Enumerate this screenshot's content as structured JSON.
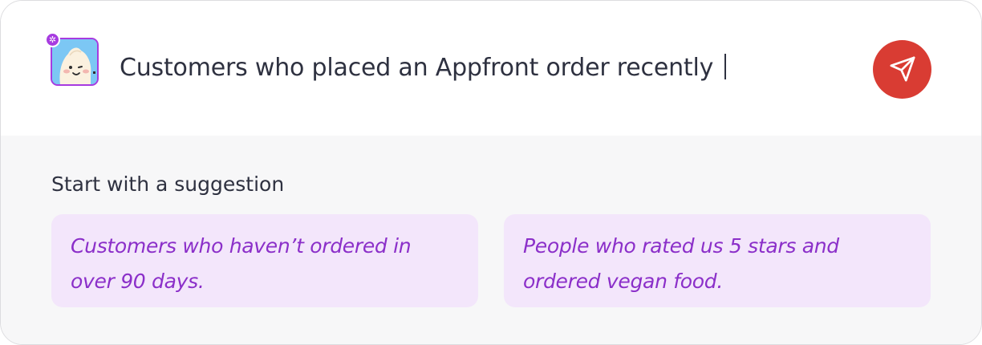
{
  "prompt": {
    "query_text": "Customers who placed an Appfront order recently",
    "avatar_icon": "dumpling-mascot-icon",
    "avatar_badge_icon": "sparkle-icon",
    "send_icon": "send-icon"
  },
  "suggestions": {
    "heading": "Start with a suggestion",
    "items": [
      {
        "label": "Customers who haven’t ordered in over 90 days."
      },
      {
        "label": "People who rated us 5 stars and ordered vegan food."
      }
    ]
  },
  "colors": {
    "accent_purple": "#a73be0",
    "chip_text": "#8b2fc9",
    "chip_bg": "#f3e6fb",
    "send_button": "#d93c33",
    "panel_bg": "#f7f7f8",
    "text": "#2e3140"
  }
}
